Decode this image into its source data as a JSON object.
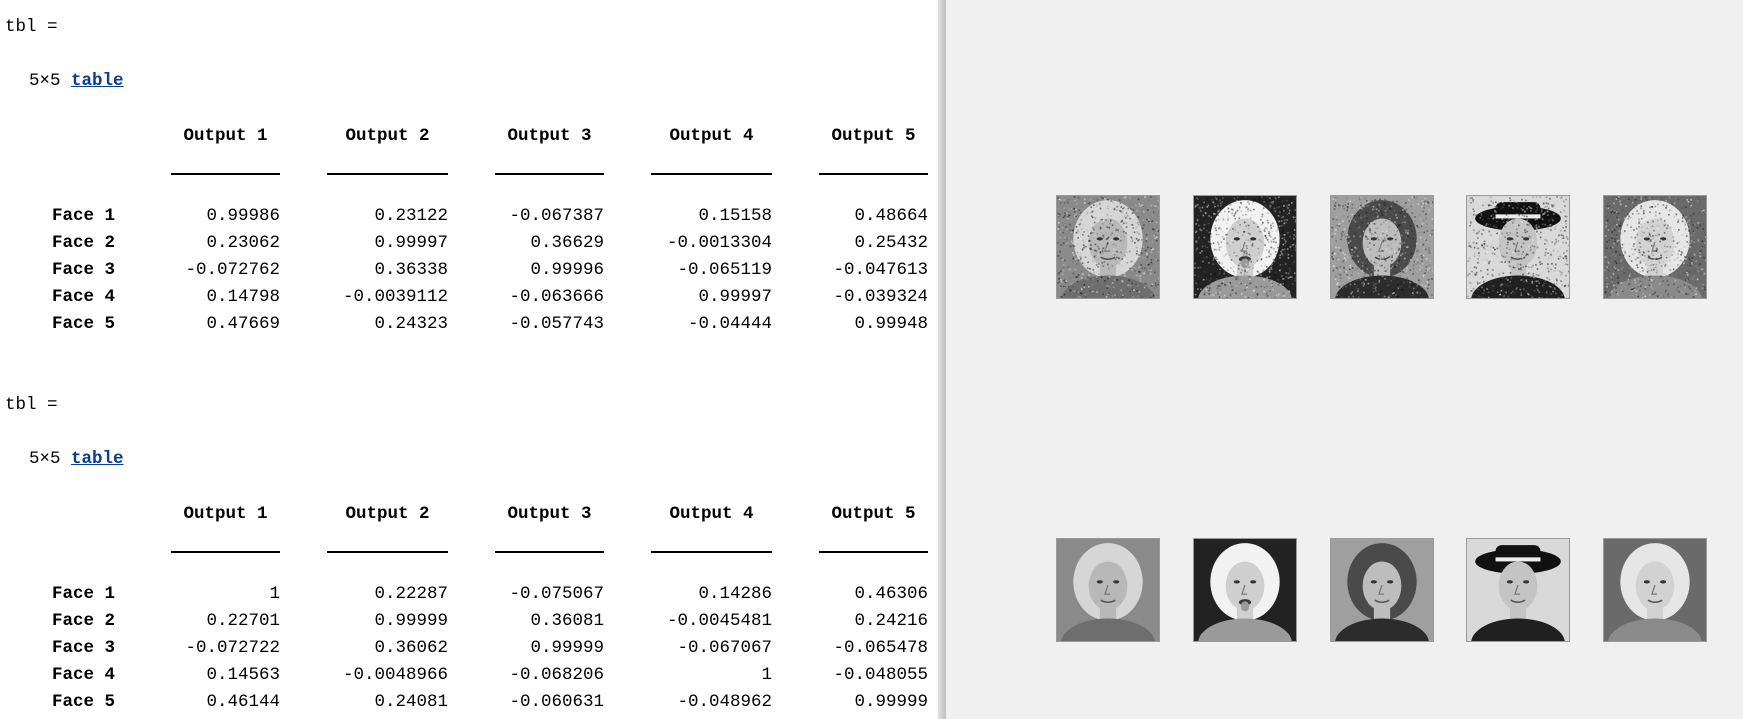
{
  "outputs": [
    {
      "var_label": "tbl =",
      "size_text": "5×5 ",
      "table_link": "table",
      "columns": [
        "Output 1",
        "Output 2",
        "Output 3",
        "Output 4",
        "Output 5"
      ],
      "rows": [
        {
          "name": "Face 1",
          "values": [
            "0.99986",
            "0.23122",
            "-0.067387",
            "0.15158",
            "0.48664"
          ]
        },
        {
          "name": "Face 2",
          "values": [
            "0.23062",
            "0.99997",
            "0.36629",
            "-0.0013304",
            "0.25432"
          ]
        },
        {
          "name": "Face 3",
          "values": [
            "-0.072762",
            "0.36338",
            "0.99996",
            "-0.065119",
            "-0.047613"
          ]
        },
        {
          "name": "Face 4",
          "values": [
            "0.14798",
            "-0.0039112",
            "-0.063666",
            "0.99997",
            "-0.039324"
          ]
        },
        {
          "name": "Face 5",
          "values": [
            "0.47669",
            "0.24323",
            "-0.057743",
            "-0.04444",
            "0.99948"
          ]
        }
      ]
    },
    {
      "var_label": "tbl =",
      "size_text": "5×5 ",
      "table_link": "table",
      "columns": [
        "Output 1",
        "Output 2",
        "Output 3",
        "Output 4",
        "Output 5"
      ],
      "rows": [
        {
          "name": "Face 1",
          "values": [
            "1",
            "0.22287",
            "-0.075067",
            "0.14286",
            "0.46306"
          ]
        },
        {
          "name": "Face 2",
          "values": [
            "0.22701",
            "0.99999",
            "0.36081",
            "-0.0045481",
            "0.24216"
          ]
        },
        {
          "name": "Face 3",
          "values": [
            "-0.072722",
            "0.36062",
            "0.99999",
            "-0.067067",
            "-0.065478"
          ]
        },
        {
          "name": "Face 4",
          "values": [
            "0.14563",
            "-0.0048966",
            "-0.068206",
            "1",
            "-0.048055"
          ]
        },
        {
          "name": "Face 5",
          "values": [
            "0.46144",
            "0.24081",
            "-0.060631",
            "-0.048962",
            "0.99999"
          ]
        }
      ]
    }
  ],
  "figure": {
    "rows": [
      {
        "kind": "noisy",
        "faces": [
          "face-1-noisy",
          "face-2-noisy",
          "face-3-noisy",
          "face-4-noisy",
          "face-5-noisy"
        ]
      },
      {
        "kind": "clean",
        "faces": [
          "face-1-clean",
          "face-2-clean",
          "face-3-clean",
          "face-4-clean",
          "face-5-clean"
        ]
      }
    ],
    "colors": {
      "pane": "#f0f0f0",
      "link": "#0b3d91"
    }
  }
}
